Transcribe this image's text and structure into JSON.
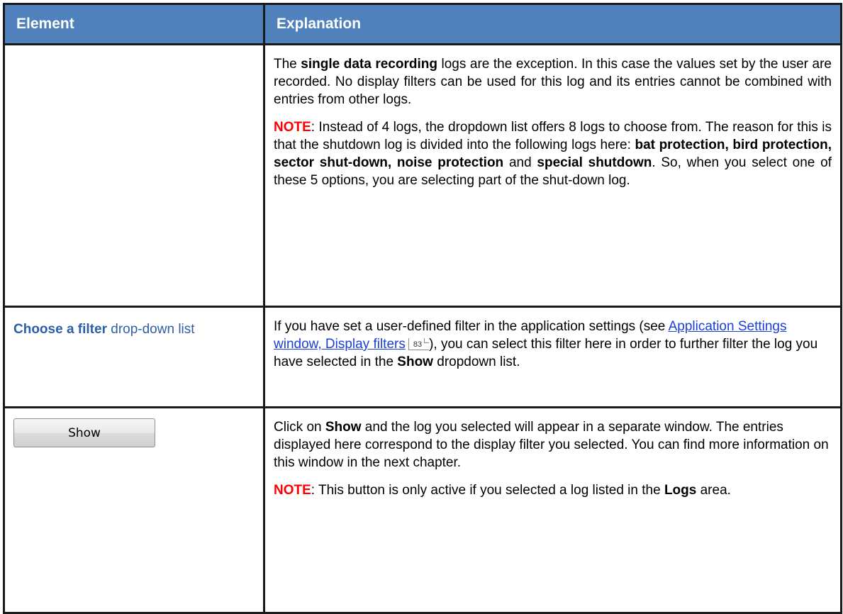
{
  "table": {
    "headers": {
      "element": "Element",
      "explanation": "Explanation"
    },
    "row1": {
      "para1": {
        "t1": "The ",
        "b1": "single data recording",
        "t2": " logs are the exception. In this case the values set by the user are recorded. No display filters can be used for this log and its entries cannot be combined with entries from other logs."
      },
      "note1": {
        "label": "NOTE",
        "t1": ": Instead of 4 logs, the dropdown list offers 8 logs to choose from. The reason for this is that the shutdown log is divided into the following logs here: ",
        "b1": "bat protection, bird protection, sector shut-down, noise protection",
        "t2": " and ",
        "b2": "special shutdown",
        "t3": ". So, when you select one of these 5 options, you are selecting part of the shut-down log."
      }
    },
    "row2": {
      "element": {
        "bold": "Choose a filter",
        "rest": " drop-down list"
      },
      "para1": {
        "t1": "If you have set a user-defined filter in the application settings (see ",
        "link": "Application Settings window, Display filters",
        "page": "83",
        "t2": "), you can select this filter here in order to further filter the log you have selected in the ",
        "b1": "Show",
        "t3": " dropdown list."
      }
    },
    "row3": {
      "button_label": "Show",
      "para1": {
        "t1": "Click on ",
        "b1": "Show",
        "t2": " and the log you selected will appear in a separate window. The entries displayed here correspond to the display filter you selected. You can find more information on this window in the next chapter."
      },
      "note1": {
        "label": "NOTE",
        "t1": ": This button is only active if you selected a log listed in the ",
        "b1": "Logs",
        "t2": " area."
      }
    }
  },
  "colors": {
    "header_bg": "#4f81bd",
    "note": "#ff0000",
    "link": "#1a3fd6",
    "element_label": "#2e5ea6"
  }
}
